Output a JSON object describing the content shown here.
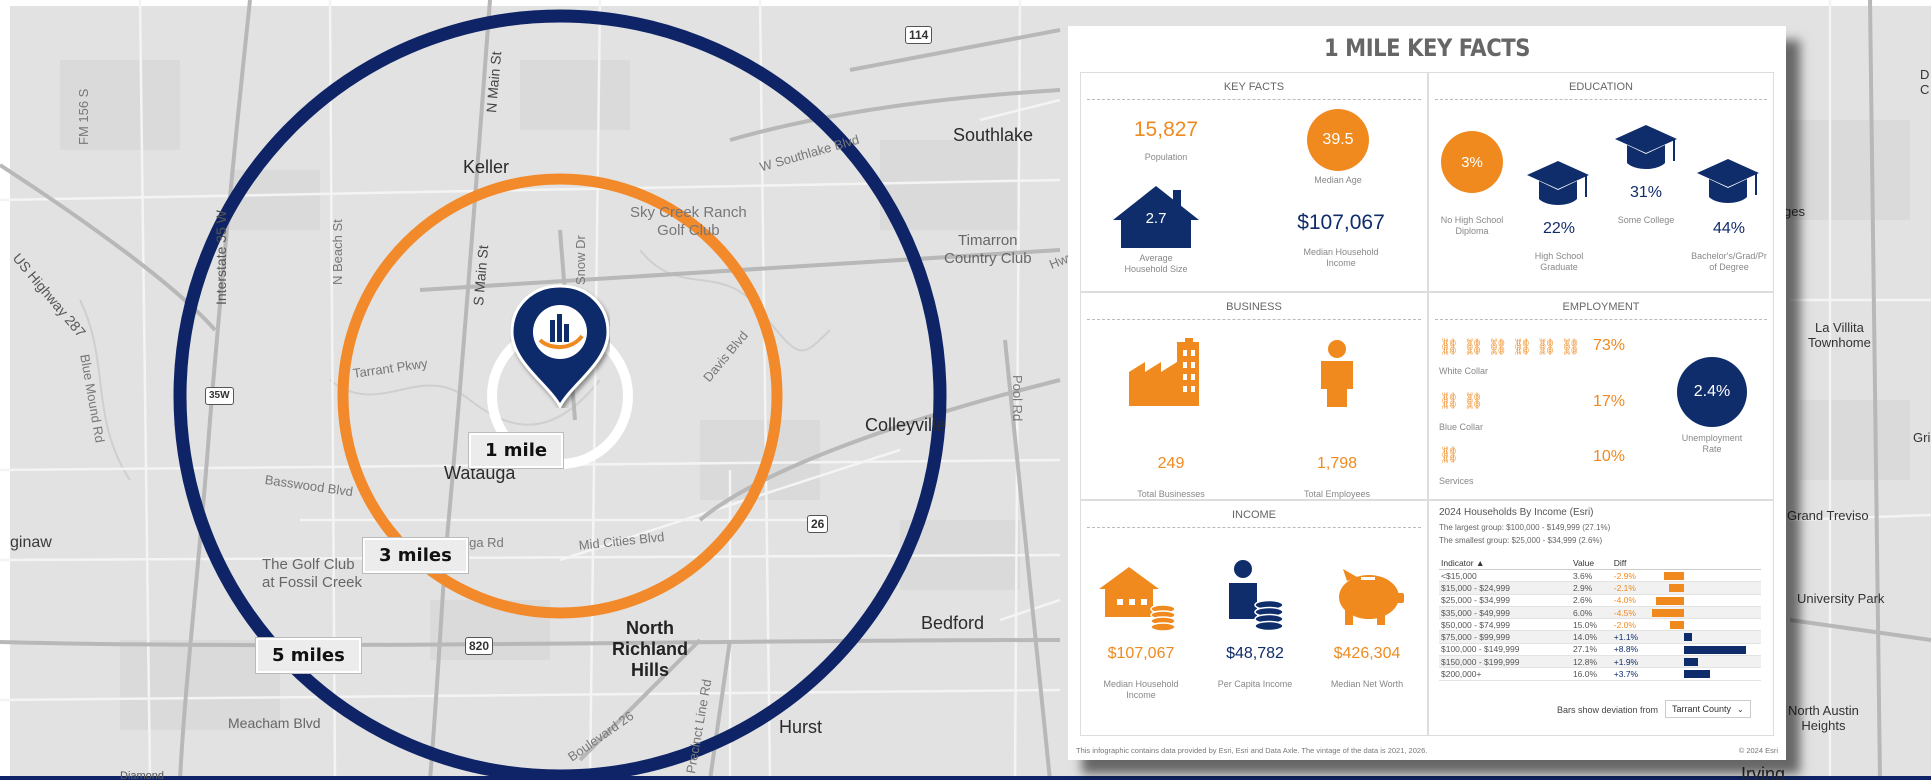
{
  "map": {
    "places": {
      "keller": "Keller",
      "southlake": "Southlake",
      "colleyville": "Colleyville",
      "watauga": "Watauga",
      "north_richland_hills": "North\nRichland\nHills",
      "bedford": "Bedford",
      "hurst": "Hurst",
      "timarron": "Timarron\nCountry Club",
      "sky_creek": "Sky Creek Ranch\nGolf Club",
      "golf_club": "The Golf Club\nat Fossil Creek",
      "saginaw": "ginaw",
      "la_villita": "La Villita\nTownhome",
      "grand_treviso": "Grand Treviso",
      "university_park": "University Park",
      "north_austin": "North Austin\nHeights",
      "irving": "Irving",
      "gri": "Gri",
      "ges": "ges",
      "d_c": "D\nC",
      "diamond": "Diamond"
    },
    "roads": {
      "us287": "US Highway 287",
      "i35": "Interstate 35 W",
      "n_main": "N Main St",
      "s_main": "S Main St",
      "n_beach": "N Beach St",
      "snow_dr": "Snow Dr",
      "southlake_blvd": "W Southlake Blvd",
      "davis_blvd": "Davis Blvd",
      "pool_rd": "Pool Rd",
      "tarrant_pkwy": "Tarrant Pkwy",
      "basswood": "Basswood Blvd",
      "watauga_rd": "Watauga Rd",
      "mid_cities": "Mid Cities Blvd",
      "meacham": "Meacham Blvd",
      "fm156": "FM 156 S",
      "blue_mound": "Blue Mound Rd",
      "boulevard26": "Boulevard 26",
      "rufe_snow": "Rufe Snow Dr",
      "precinct": "Precinct Line Rd",
      "colleyville_hwy": "Hwy",
      "shield_114": "114",
      "shield_26": "26",
      "shield_820": "820",
      "shield_35w": "35W"
    },
    "radius_labels": {
      "r1": "1 mile",
      "r3": "3 miles",
      "r5": "5 miles"
    },
    "colors": {
      "ring5": "#0f2466",
      "ring3": "#f28a2b",
      "ring1": "#ffffff",
      "pin": "#0f2c6b"
    }
  },
  "panel": {
    "title": "1 MILE KEY FACTS",
    "key_facts": {
      "title": "KEY FACTS",
      "population_value": "15,827",
      "population_label": "Population",
      "median_age_value": "39.5",
      "median_age_label": "Median Age",
      "household_size_value": "2.7",
      "household_size_label": "Average\nHousehold Size",
      "median_household_income_value": "$107,067",
      "median_household_income_label": "Median Household\nIncome"
    },
    "education": {
      "title": "EDUCATION",
      "no_hs_value": "3%",
      "no_hs_label": "No High School\nDiploma",
      "hs_grad_value": "22%",
      "hs_grad_label": "High School\nGraduate",
      "some_college_value": "31%",
      "some_college_label": "Some College",
      "bachelors_value": "44%",
      "bachelors_label": "Bachelor's/Grad/Pr\nof Degree"
    },
    "business": {
      "title": "BUSINESS",
      "total_businesses_value": "249",
      "total_businesses_label": "Total Businesses",
      "total_employees_value": "1,798",
      "total_employees_label": "Total Employees"
    },
    "employment": {
      "title": "EMPLOYMENT",
      "white_collar_value": "73%",
      "white_collar_label": "White Collar",
      "blue_collar_value": "17%",
      "blue_collar_label": "Blue Collar",
      "services_value": "10%",
      "services_label": "Services",
      "unemployment_value": "2.4%",
      "unemployment_label": "Unemployment\nRate"
    },
    "income": {
      "title": "INCOME",
      "median_household_income_value": "$107,067",
      "median_household_income_label": "Median Household\nIncome",
      "per_capita_value": "$48,782",
      "per_capita_label": "Per Capita Income",
      "net_worth_value": "$426,304",
      "net_worth_label": "Median Net Worth"
    },
    "households_by_income": {
      "title": "2024 Households By Income (Esri)",
      "largest": "The largest group: $100,000 - $149,999 (27.1%)",
      "smallest": "The smallest group: $25,000 - $34,999 (2.6%)",
      "columns": [
        "Indicator ▲",
        "Value",
        "Diff"
      ],
      "rows": [
        {
          "indicator": "<$15,000",
          "value": "3.6%",
          "diff": "-2.9%",
          "d": -2.9
        },
        {
          "indicator": "$15,000 - $24,999",
          "value": "2.9%",
          "diff": "-2.1%",
          "d": -2.1
        },
        {
          "indicator": "$25,000 - $34,999",
          "value": "2.6%",
          "diff": "-4.0%",
          "d": -4.0
        },
        {
          "indicator": "$35,000 - $49,999",
          "value": "6.0%",
          "diff": "-4.5%",
          "d": -4.5
        },
        {
          "indicator": "$50,000 - $74,999",
          "value": "15.0%",
          "diff": "-2.0%",
          "d": -2.0
        },
        {
          "indicator": "$75,000 - $99,999",
          "value": "14.0%",
          "diff": "+1.1%",
          "d": 1.1
        },
        {
          "indicator": "$100,000 - $149,999",
          "value": "27.1%",
          "diff": "+8.8%",
          "d": 8.8
        },
        {
          "indicator": "$150,000 - $199,999",
          "value": "12.8%",
          "diff": "+1.9%",
          "d": 1.9
        },
        {
          "indicator": "$200,000+",
          "value": "16.0%",
          "diff": "+3.7%",
          "d": 3.7
        }
      ],
      "deviation_label": "Bars show deviation from",
      "deviation_select": "Tarrant County"
    },
    "footer_note": "This infographic contains data provided by Esri, Esri and Data Axle. The vintage of the data is 2021, 2026.",
    "footer_copy": "© 2024 Esri",
    "colors": {
      "orange": "#f08a1e",
      "navy": "#0f2c6b"
    }
  }
}
